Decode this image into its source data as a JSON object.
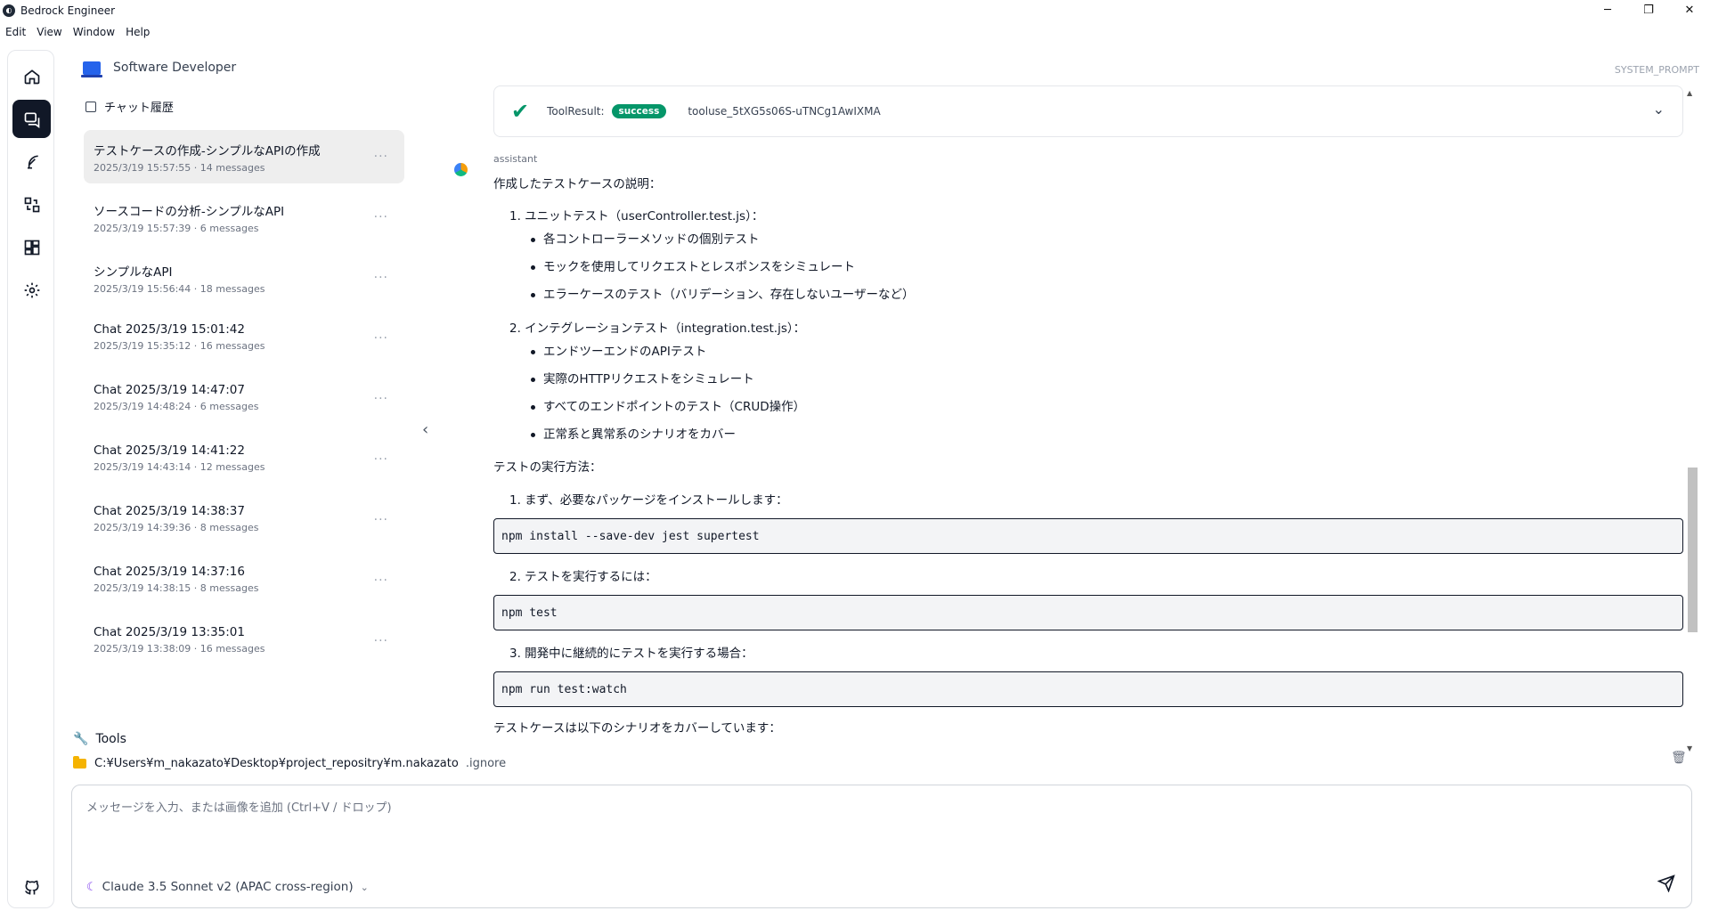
{
  "window": {
    "title": "Bedrock Engineer",
    "controls": [
      "minimize",
      "restore",
      "close"
    ]
  },
  "menu": [
    "Edit",
    "View",
    "Window",
    "Help"
  ],
  "rail": {
    "items": [
      {
        "name": "home",
        "icon": "home-icon",
        "active": false
      },
      {
        "name": "chat",
        "icon": "chat-icon",
        "active": true
      },
      {
        "name": "feather",
        "icon": "feather-icon",
        "active": false
      },
      {
        "name": "diff",
        "icon": "diff-icon",
        "active": false
      },
      {
        "name": "dashboard",
        "icon": "dashboard-icon",
        "active": false
      },
      {
        "name": "settings",
        "icon": "gear-icon",
        "active": false
      }
    ],
    "bottom_icon": "github-icon"
  },
  "sidebar": {
    "agent_name": "Software Developer",
    "history_label": "チャット履歴",
    "chats": [
      {
        "title": "テストケースの作成-シンプルなAPIの作成",
        "meta": "2025/3/19 15:57:55 · 14 messages",
        "selected": true
      },
      {
        "title": "ソースコードの分析-シンプルなAPI",
        "meta": "2025/3/19 15:57:39 · 6 messages",
        "selected": false
      },
      {
        "title": "シンプルなAPI",
        "meta": "2025/3/19 15:56:44 · 18 messages",
        "selected": false
      },
      {
        "title": "Chat 2025/3/19 15:01:42",
        "meta": "2025/3/19 15:35:12 · 16 messages",
        "selected": false
      },
      {
        "title": "Chat 2025/3/19 14:47:07",
        "meta": "2025/3/19 14:48:24 · 6 messages",
        "selected": false
      },
      {
        "title": "Chat 2025/3/19 14:41:22",
        "meta": "2025/3/19 14:43:14 · 12 messages",
        "selected": false
      },
      {
        "title": "Chat 2025/3/19 14:38:37",
        "meta": "2025/3/19 14:39:36 · 8 messages",
        "selected": false
      },
      {
        "title": "Chat 2025/3/19 14:37:16",
        "meta": "2025/3/19 14:38:15 · 8 messages",
        "selected": false
      },
      {
        "title": "Chat 2025/3/19 13:35:01",
        "meta": "2025/3/19 13:38:09 · 16 messages",
        "selected": false
      }
    ],
    "more_glyph": "···"
  },
  "header": {
    "system_prompt": "SYSTEM_PROMPT"
  },
  "tool_result": {
    "label": "ToolResult:",
    "status": "success",
    "id": "tooluse_5tXG5s06S-uTNCg1AwIXMA"
  },
  "message": {
    "role": "assistant",
    "intro": "作成したテストケースの説明：",
    "section1": {
      "title": "1. ユニットテスト（userController.test.js）：",
      "bullets": [
        "各コントローラーメソッドの個別テスト",
        "モックを使用してリクエストとレスポンスをシミュレート",
        "エラーケースのテスト（バリデーション、存在しないユーザーなど）"
      ]
    },
    "section2": {
      "title": "2. インテグレーションテスト（integration.test.js）：",
      "bullets": [
        "エンドツーエンドのAPIテスト",
        "実際のHTTPリクエストをシミュレート",
        "すべてのエンドポイントのテスト（CRUD操作）",
        "正常系と異常系のシナリオをカバー"
      ]
    },
    "run_title": "テストの実行方法：",
    "step1": "1. まず、必要なパッケージをインストールします：",
    "code1": "npm install --save-dev jest supertest",
    "step2": "2. テストを実行するには：",
    "code2": "npm test",
    "step3": "3. 開発中に継続的にテストを実行する場合：",
    "code3": "npm run test:watch",
    "outro": "テストケースは以下のシナリオをカバーしています："
  },
  "bottom": {
    "tools_label": "Tools",
    "path": "C:¥Users¥m_nakazato¥Desktop¥project_repositry¥m.nakazato",
    "ignore_label": ".ignore"
  },
  "composer": {
    "placeholder": "メッセージを入力、または画像を追加 (Ctrl+V / ドロップ)",
    "value": "",
    "model": "Claude 3.5 Sonnet v2 (APAC cross-region)"
  },
  "colors": {
    "accent": "#111827",
    "success": "#059669",
    "agent_icon": "#2563eb",
    "folder": "#f5b301"
  }
}
